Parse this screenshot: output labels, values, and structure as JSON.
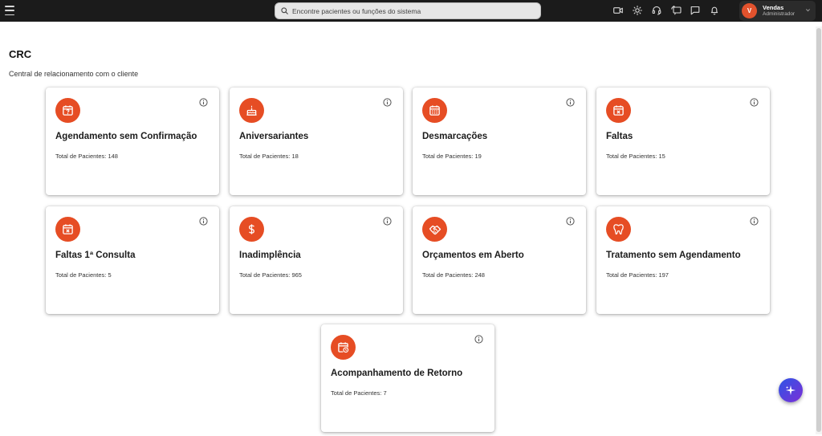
{
  "topbar": {
    "search_placeholder": "Encontre pacientes ou funções do sistema",
    "icons": [
      "video-icon",
      "sun-icon",
      "headset-icon",
      "refresh-chat-icon",
      "chat-icon",
      "bell-icon"
    ],
    "user": {
      "initial": "V",
      "name": "Vendas",
      "role": "Administrador"
    }
  },
  "page": {
    "title": "CRC",
    "subtitle": "Central de relacionamento com o cliente"
  },
  "cards": [
    {
      "title": "Agendamento sem Confirmação",
      "count": "Total de Pacientes: 148",
      "icon": "calendar-question-icon"
    },
    {
      "title": "Aniversariantes",
      "count": "Total de Pacientes: 18",
      "icon": "cake-icon"
    },
    {
      "title": "Desmarcações",
      "count": "Total de Pacientes: 19",
      "icon": "calendar-grid-icon"
    },
    {
      "title": "Faltas",
      "count": "Total de Pacientes: 15",
      "icon": "calendar-x-icon"
    },
    {
      "title": "Faltas 1ª Consulta",
      "count": "Total de Pacientes: 5",
      "icon": "calendar-x-icon"
    },
    {
      "title": "Inadimplência",
      "count": "Total de Pacientes: 965",
      "icon": "dollar-icon"
    },
    {
      "title": "Orçamentos em Aberto",
      "count": "Total de Pacientes: 248",
      "icon": "handshake-icon"
    },
    {
      "title": "Tratamento sem Agendamento",
      "count": "Total de Pacientes: 197",
      "icon": "tooth-icon"
    },
    {
      "title": "Acompanhamento de Retorno",
      "count": "Total de Pacientes: 7",
      "icon": "calendar-clock-icon"
    }
  ],
  "colors": {
    "accent": "#e64d24",
    "topbar": "#1b1b1b",
    "fab_start": "#2e55e6",
    "fab_end": "#7b2fd6"
  }
}
